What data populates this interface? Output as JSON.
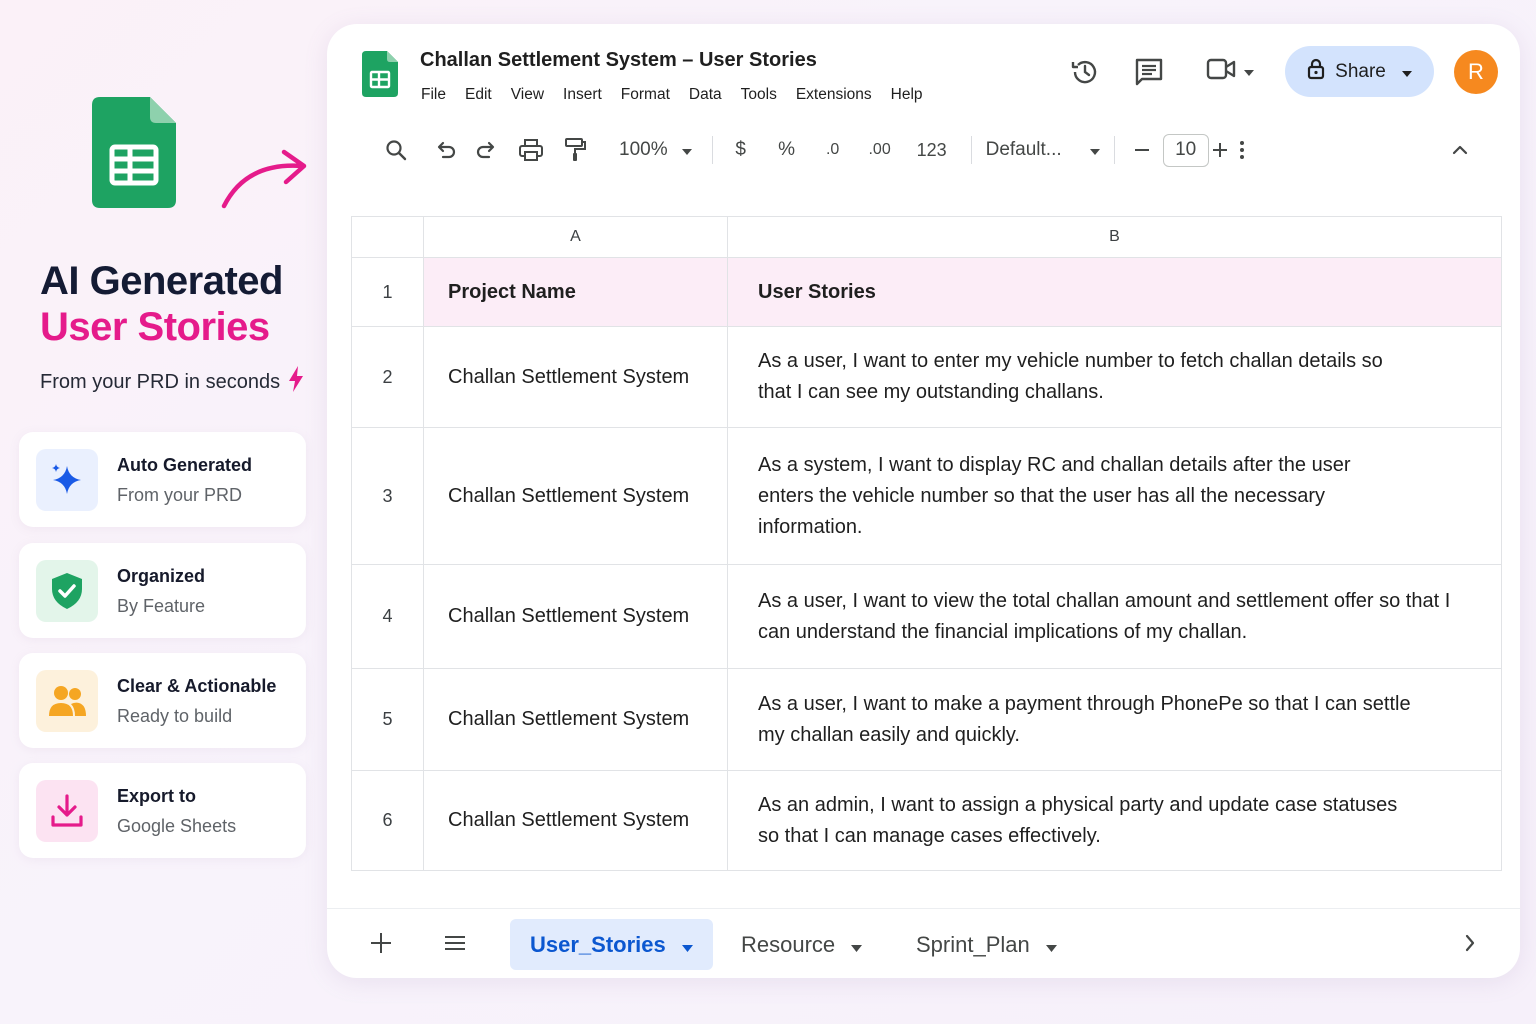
{
  "promo": {
    "title_line1": "AI Generated",
    "title_line2": "User Stories",
    "subtitle": "From your PRD in seconds",
    "features": [
      {
        "title": "Auto Generated",
        "subtitle": "From your PRD",
        "icon": "sparkle-icon"
      },
      {
        "title": "Organized",
        "subtitle": "By Feature",
        "icon": "shield-check-icon"
      },
      {
        "title": "Clear & Actionable",
        "subtitle": "Ready to build",
        "icon": "users-icon"
      },
      {
        "title": "Export to",
        "subtitle": "Google Sheets",
        "icon": "download-icon"
      }
    ]
  },
  "doc": {
    "title": "Challan Settlement System – User Stories",
    "menu": [
      "File",
      "Edit",
      "View",
      "Insert",
      "Format",
      "Data",
      "Tools",
      "Extensions",
      "Help"
    ],
    "share_label": "Share",
    "avatar_letter": "R"
  },
  "toolbar": {
    "zoom": "100%",
    "currency": "$",
    "percent": "%",
    "decrease_decimal": ".0",
    "increase_decimal": ".00",
    "number_format": "123",
    "font": "Default...",
    "font_size": "10"
  },
  "sheet": {
    "columns": [
      "A",
      "B"
    ],
    "header": {
      "row": "1",
      "a": "Project Name",
      "b": "User Stories"
    },
    "rows": [
      {
        "row": "2",
        "a": "Challan Settlement System",
        "b": "As a user, I want to enter my vehicle number to fetch challan details so that I can see my outstanding challans."
      },
      {
        "row": "3",
        "a": "Challan Settlement System",
        "b": "As a system, I want to display RC and challan details after the user enters the vehicle number so that the user has all the necessary information."
      },
      {
        "row": "4",
        "a": "Challan Settlement System",
        "b": "As a user, I want to view the total challan amount and settlement offer so that I can understand the financial implications of my challan."
      },
      {
        "row": "5",
        "a": "Challan Settlement System",
        "b": "As a user, I want to make a payment through PhonePe so that I can settle my challan easily and quickly."
      },
      {
        "row": "6",
        "a": "Challan Settlement System",
        "b": "As an admin, I want to assign a physical party and update case statuses so that I can manage cases effectively."
      }
    ]
  },
  "tabs": [
    "User_Stories",
    "Resource",
    "Sprint_Plan"
  ],
  "colors": {
    "accent_pink": "#e51b8b",
    "sheets_green": "#1ea362",
    "share_bg": "#d3e3fd",
    "avatar": "#f6891f",
    "header_row_bg": "#fcedf7"
  }
}
